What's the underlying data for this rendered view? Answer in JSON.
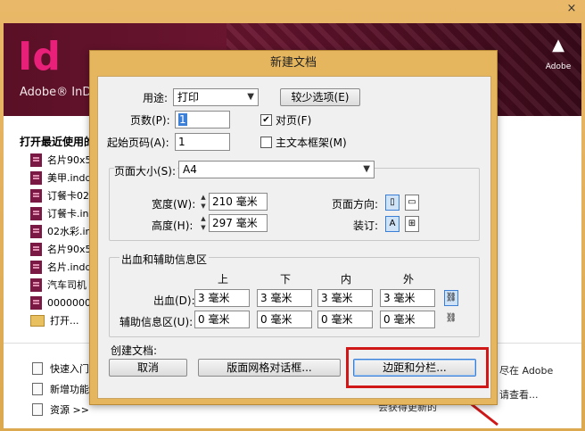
{
  "outer": {
    "close_glyph": "×",
    "logo_text": "Id",
    "brand_text": "Adobe® InD",
    "adobe_logo_text": "Adobe"
  },
  "recent": {
    "heading": "打开最近使用的",
    "items": [
      "名片90x5",
      "美甲.indd",
      "订餐卡02",
      "订餐卡.in",
      "02水彩.in",
      "名片90x5",
      "名片.indd",
      "汽车司机",
      "0000000"
    ],
    "open_label": "打开..."
  },
  "bottom": {
    "links": [
      "快速入门",
      "新增功能",
      "资源 >>"
    ],
    "side_text_1": "尽在 Adobe",
    "side_text_2": "请查看...",
    "side_text_3": "会获得更新的"
  },
  "dialog": {
    "title": "新建文档",
    "intent_label": "用途:",
    "intent_value": "打印",
    "fewer_options": "较少选项(E)",
    "pages_label": "页数(P):",
    "pages_value": "1",
    "facing_pages": "对页(F)",
    "start_page_label": "起始页码(A):",
    "start_page_value": "1",
    "master_text_frame": "主文本框架(M)",
    "page_size_label": "页面大小(S):",
    "page_size_value": "A4",
    "width_label": "宽度(W):",
    "width_value": "210 毫米",
    "height_label": "高度(H):",
    "height_value": "297 毫米",
    "orientation_label": "页面方向:",
    "binding_label": "装订:",
    "bleed_group_title": "出血和辅助信息区",
    "col_top": "上",
    "col_bottom": "下",
    "col_inside": "内",
    "col_outside": "外",
    "bleed_label": "出血(D):",
    "bleed_values": [
      "3 毫米",
      "3 毫米",
      "3 毫米",
      "3 毫米"
    ],
    "slug_label": "辅助信息区(U):",
    "slug_values": [
      "0 毫米",
      "0 毫米",
      "0 毫米",
      "0 毫米"
    ],
    "create_doc_label": "创建文档:",
    "cancel": "取消",
    "layout_grid": "版面网格对话框...",
    "margins_columns": "边距和分栏..."
  }
}
